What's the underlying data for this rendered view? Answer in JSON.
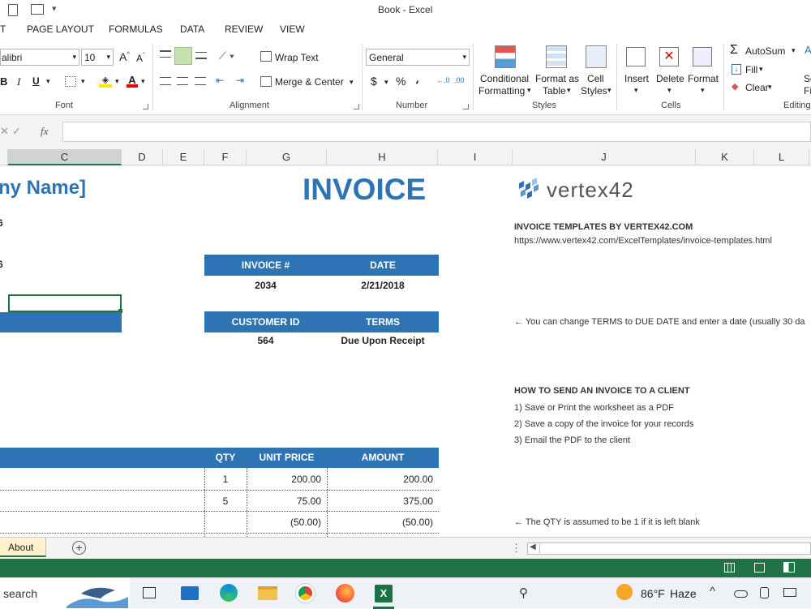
{
  "window": {
    "title": "Book - Excel",
    "autosave_glyph": "▾"
  },
  "ribbon_tabs": [
    "T",
    "PAGE LAYOUT",
    "FORMULAS",
    "DATA",
    "REVIEW",
    "VIEW"
  ],
  "font": {
    "name": "alibri",
    "size": "10",
    "group_label": "Font",
    "bold": "B",
    "italic": "I",
    "underline": "U"
  },
  "alignment": {
    "wrap_text": "Wrap Text",
    "merge_center": "Merge & Center",
    "group_label": "Alignment"
  },
  "number": {
    "format": "General",
    "currency": "$",
    "percent": "%",
    "comma": "،",
    "group_label": "Number"
  },
  "styles": {
    "conditional": "Conditional",
    "conditional2": "Formatting",
    "format_as": "Format as",
    "table": "Table",
    "cell": "Cell",
    "cell_styles": "Styles",
    "group_label": "Styles"
  },
  "cells": {
    "insert": "Insert",
    "delete": "Delete",
    "format": "Format",
    "group_label": "Cells"
  },
  "editing": {
    "autosum": "AutoSum",
    "fill": "Fill",
    "clear": "Clear",
    "sort1": "So",
    "sort2": "Fi",
    "group_label": "Editing"
  },
  "formula_bar": {
    "fx": "fx",
    "value": ""
  },
  "columns": [
    "C",
    "D",
    "E",
    "F",
    "G",
    "H",
    "I",
    "J",
    "K",
    "L"
  ],
  "sheet": {
    "company": "ny Name]",
    "row_a": "6",
    "row_b": "6",
    "invoice_title": "INVOICE",
    "logo_text": "vertex42",
    "invoice_no_label": "INVOICE #",
    "date_label": "DATE",
    "invoice_no": "2034",
    "date": "2/21/2018",
    "customer_id_label": "CUSTOMER ID",
    "terms_label": "TERMS",
    "customer_id": "564",
    "terms": "Due Upon Receipt",
    "qty_label": "QTY",
    "unit_price_label": "UNIT PRICE",
    "amount_label": "AMOUNT",
    "items": [
      {
        "qty": "1",
        "unit": "200.00",
        "amount": "200.00"
      },
      {
        "qty": "5",
        "unit": "75.00",
        "amount": "375.00"
      },
      {
        "qty": "",
        "unit": "(50.00)",
        "amount": "(50.00)"
      }
    ]
  },
  "notes": {
    "templates_title": "INVOICE TEMPLATES BY VERTEX42.COM",
    "templates_url": "https://www.vertex42.com/ExcelTemplates/invoice-templates.html",
    "terms_note": "← You can change TERMS to DUE DATE and enter a date (usually 30 da",
    "howto_title": "HOW TO SEND AN INVOICE TO A CLIENT",
    "step1": "1) Save or Print the worksheet as a PDF",
    "step2": "2) Save a copy of the invoice for your records",
    "step3": "3) Email the PDF to the client",
    "qty_note": "← The QTY is assumed to be 1 if it is left blank"
  },
  "sheet_tabs": {
    "active": "About",
    "add": "+"
  },
  "taskbar": {
    "search": "search",
    "weather_temp": "86°F",
    "weather_desc": "Haze"
  },
  "colors": {
    "accent": "#2e74b5",
    "excel_green": "#217346"
  }
}
